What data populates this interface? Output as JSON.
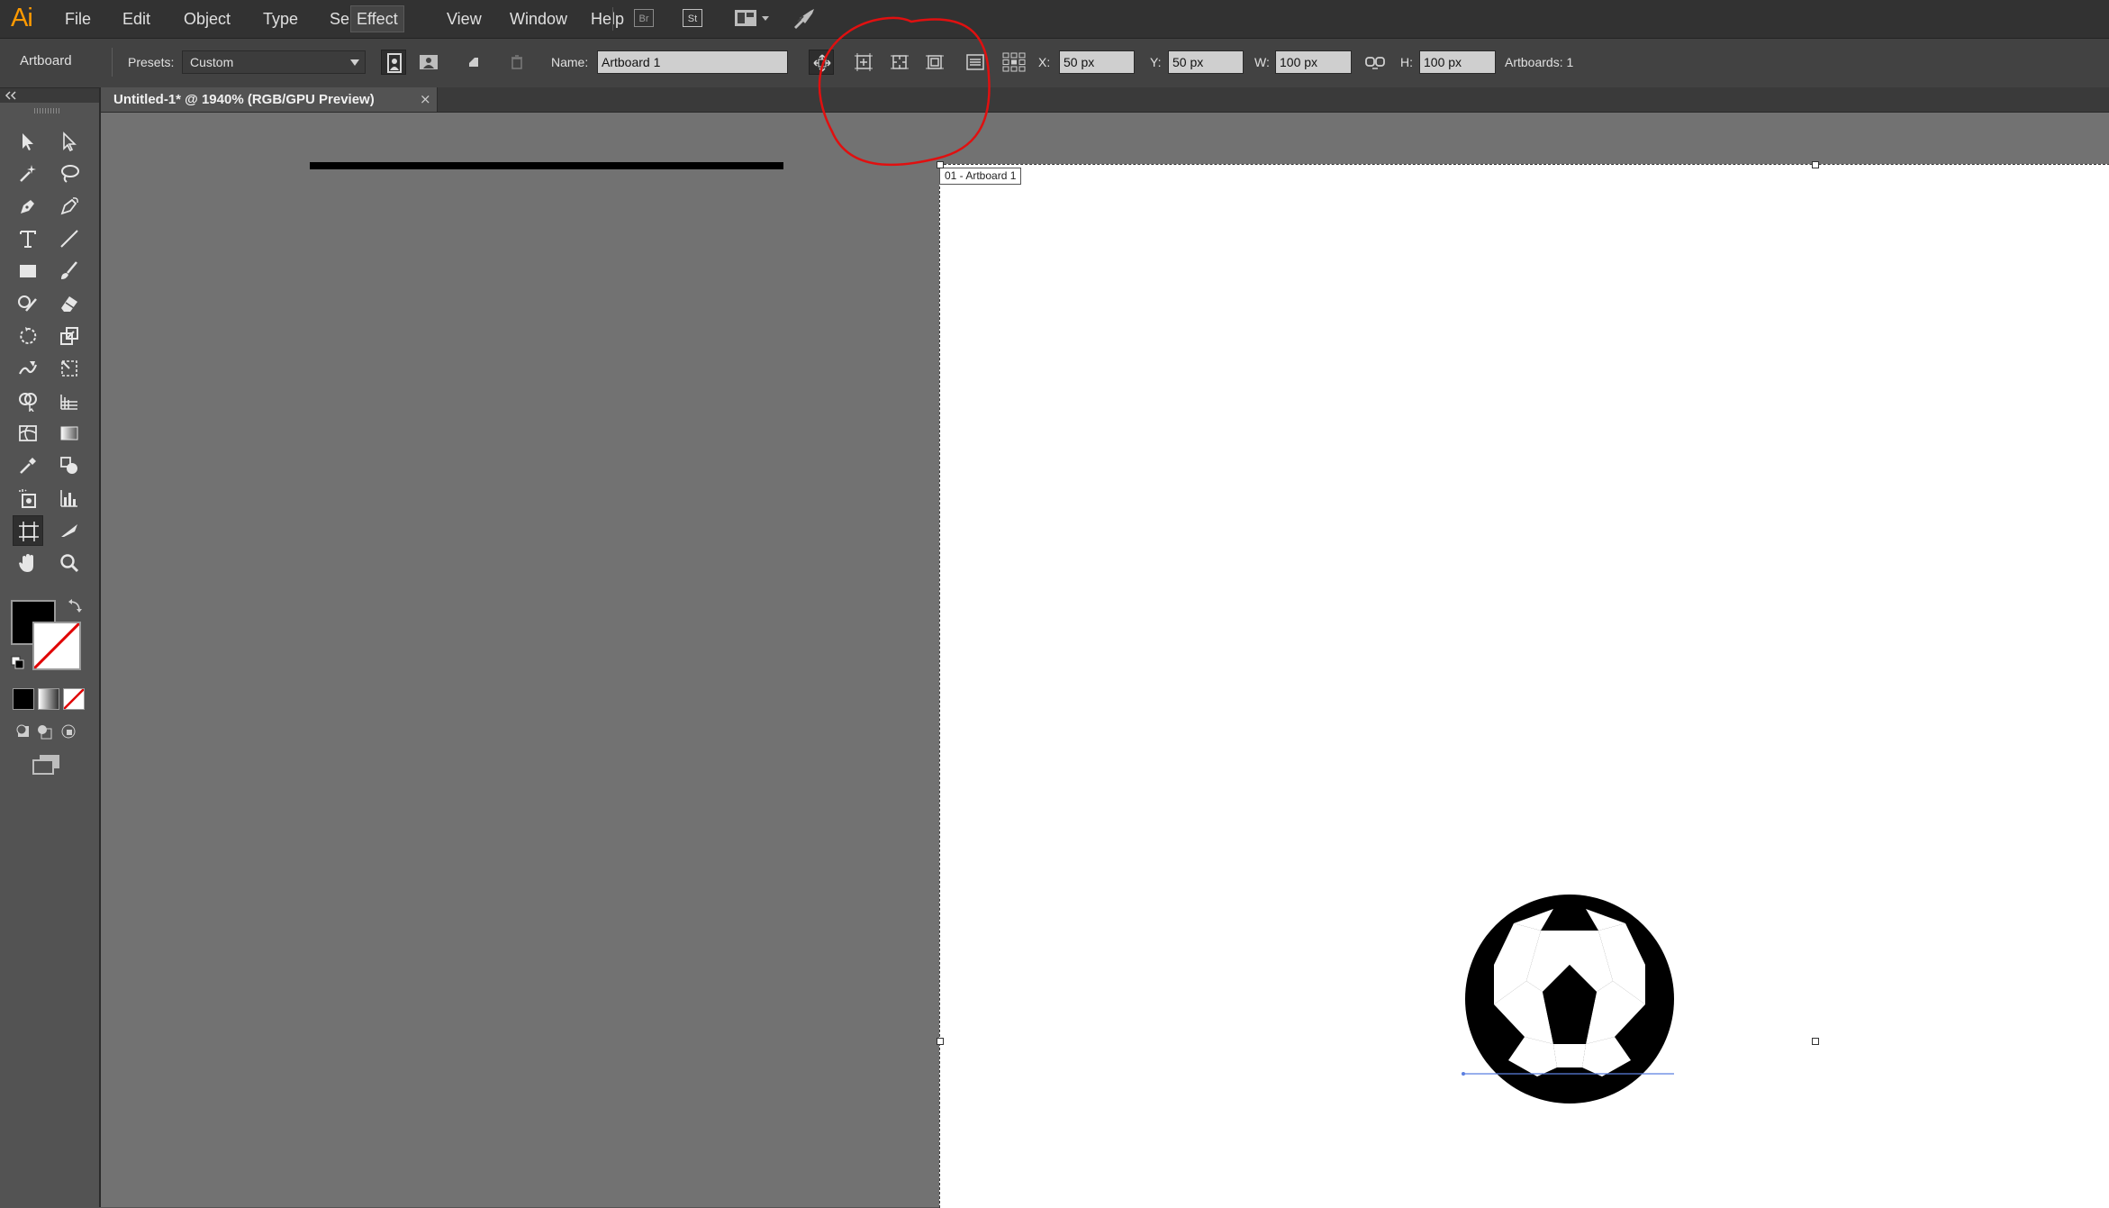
{
  "app": {
    "logo": "Ai",
    "menus": [
      "File",
      "Edit",
      "Object",
      "Type",
      "Select",
      "Effect",
      "View",
      "Window",
      "Help"
    ],
    "active_menu": "Effect",
    "bridge_label": "Br",
    "stock_label": "St"
  },
  "controlbar": {
    "mode_label": "Artboard",
    "presets_label": "Presets:",
    "presets_value": "Custom",
    "name_label": "Name:",
    "name_value": "Artboard 1",
    "x_label": "X:",
    "x_value": "50 px",
    "y_label": "Y:",
    "y_value": "50 px",
    "w_label": "W:",
    "w_value": "100 px",
    "h_label": "H:",
    "h_value": "100 px",
    "artboards_label": "Artboards: 1"
  },
  "document": {
    "tab_title": "Untitled-1* @ 1940% (RGB/GPU Preview)",
    "close_glyph": "×",
    "artboard_label": "01 - Artboard 1"
  },
  "colors": {
    "accent_logo": "#ff9a00",
    "annotation": "#e01010",
    "fill": "#000000",
    "stroke": "#ffffff",
    "none_slash": "#e00000"
  }
}
